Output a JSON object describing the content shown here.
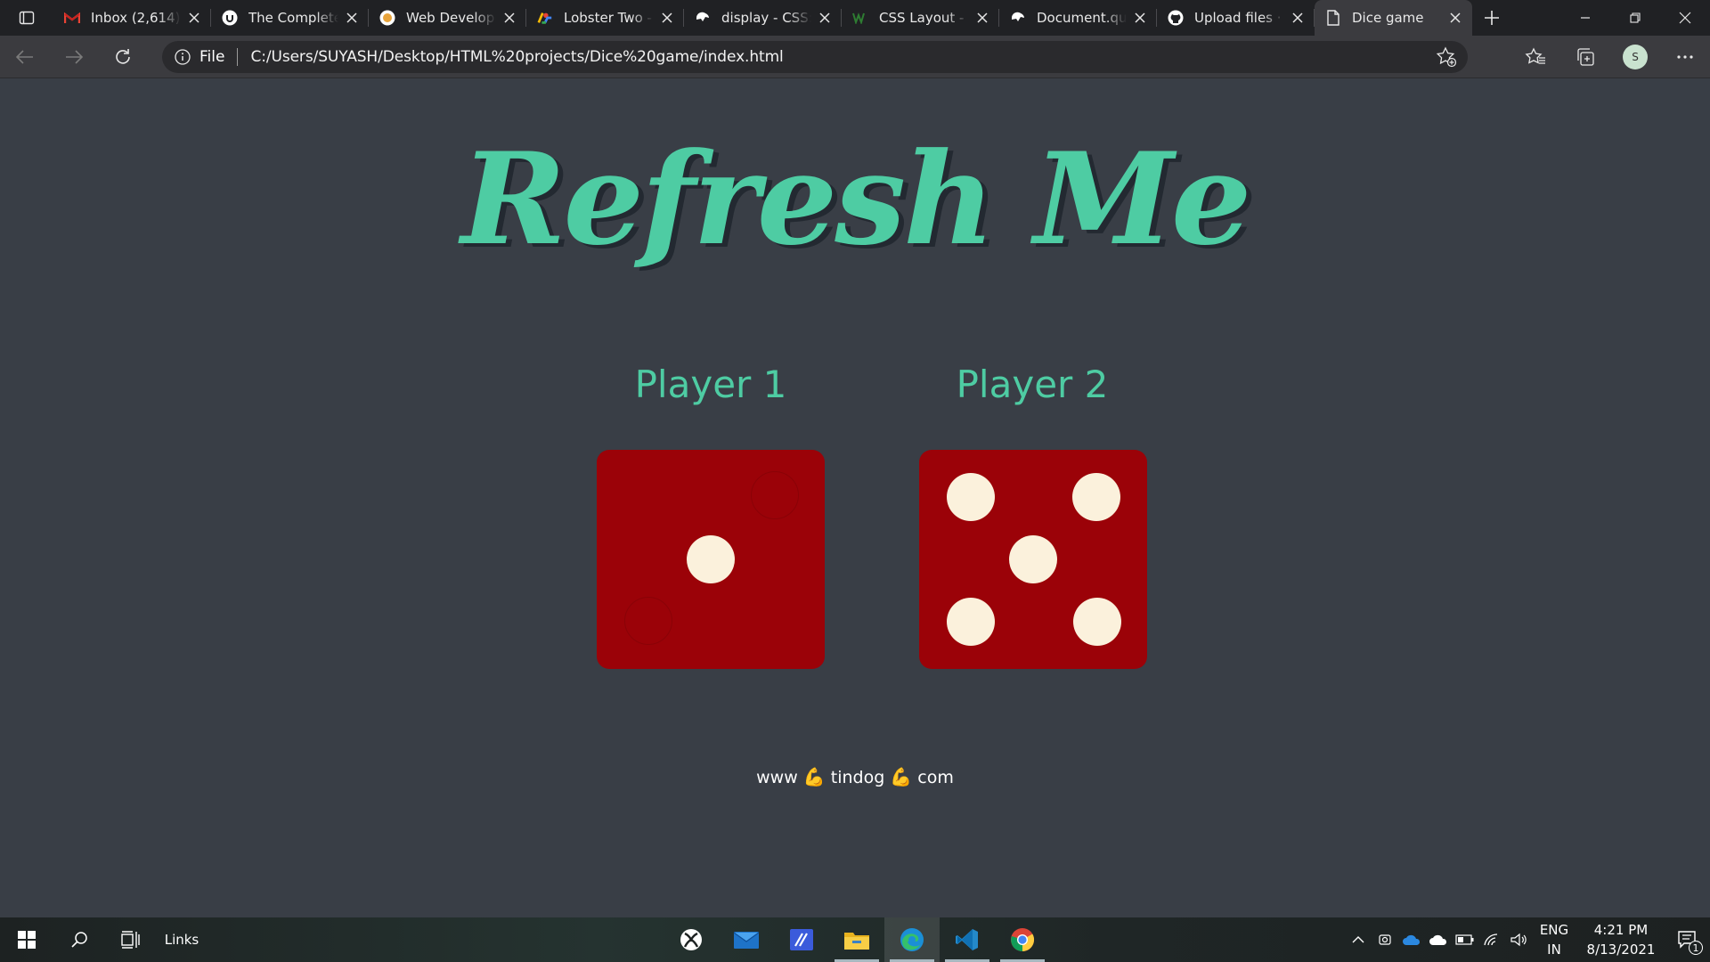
{
  "browser": {
    "tabs": [
      {
        "title": "Inbox (2,614) - ",
        "icon": "gmail-icon"
      },
      {
        "title": "The Complete",
        "icon": "udemy-icon"
      },
      {
        "title": "Web Developr",
        "icon": "udemy-icon"
      },
      {
        "title": "Lobster Two - ",
        "icon": "google-fonts-icon"
      },
      {
        "title": "display - CSS:",
        "icon": "mdn-icon"
      },
      {
        "title": "CSS Layout - i",
        "icon": "w3schools-icon"
      },
      {
        "title": "Document.que",
        "icon": "mdn-icon"
      },
      {
        "title": "Upload files · ",
        "icon": "github-icon"
      },
      {
        "title": "Dice game",
        "icon": "page-icon",
        "active": true
      }
    ],
    "address": {
      "scheme_label": "File",
      "url": "C:/Users/SUYASH/Desktop/HTML%20projects/Dice%20game/index.html"
    },
    "profile_initial": "S"
  },
  "page": {
    "headline": "Refresh Me",
    "players": [
      {
        "label": "Player 1",
        "dice_value": 1
      },
      {
        "label": "Player 2",
        "dice_value": 5
      }
    ],
    "footer": {
      "parts": [
        "www",
        "tindog",
        "com"
      ],
      "emoji": "💪"
    },
    "colors": {
      "background": "#393E46",
      "accent": "#4ECCA3",
      "dice": "#9B0208",
      "pip": "#FBF1DC"
    }
  },
  "taskbar": {
    "links_label": "Links",
    "apps": [
      "xbox-icon",
      "mail-icon",
      "powerapps-icon",
      "file-explorer-icon",
      "edge-icon",
      "vscode-icon",
      "chrome-icon"
    ],
    "language": [
      "ENG",
      "IN"
    ],
    "time": "4:21 PM",
    "date": "8/13/2021",
    "notification_count": "1"
  }
}
